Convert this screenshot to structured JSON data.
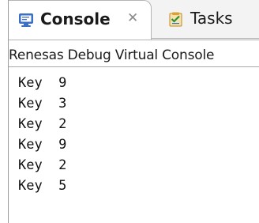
{
  "tabs": [
    {
      "label": "Console",
      "icon": "console-icon",
      "active": true
    },
    {
      "label": "Tasks",
      "icon": "tasks-icon",
      "active": false
    }
  ],
  "console": {
    "name": "Renesas Debug Virtual Console",
    "lines": [
      "Key  9",
      "Key  3",
      "Key  2",
      "Key  9",
      "Key  2",
      "Key  5"
    ]
  },
  "colors": {
    "console_icon": "#3b6fc4",
    "tasks_icon": "#e0a030",
    "border": "#b4b4b4"
  }
}
